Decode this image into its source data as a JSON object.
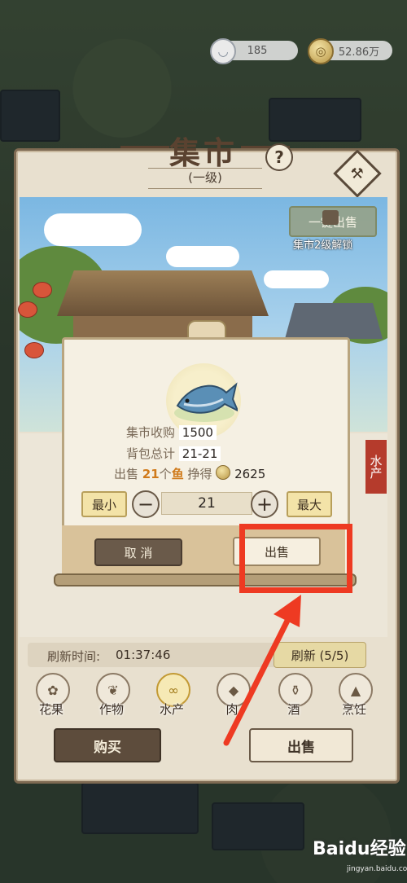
{
  "currency": {
    "bowl_value": "185",
    "coin_value": "52.86万"
  },
  "market": {
    "title": "集市",
    "level": "(一级)",
    "help_symbol": "?",
    "one_click_sell": "一键出售",
    "unlock_note": "集市2级解锁",
    "category_tag": "水产"
  },
  "sell_dialog": {
    "market_buy_label": "集市收购",
    "market_buy_value": "1500",
    "bag_total_label": "背包总计",
    "bag_total_value": "21-21",
    "sell_prefix": "出售",
    "sell_count": "21",
    "sell_unit": "个",
    "sell_item": "鱼",
    "earn_label": "挣得",
    "earn_value": "2625",
    "min_label": "最小",
    "max_label": "最大",
    "minus_symbol": "−",
    "plus_symbol": "+",
    "quantity": "21",
    "cancel_label": "取 消",
    "sell_label": "出售"
  },
  "refresh": {
    "label": "刷新时间:",
    "time": "01:37:46",
    "button": "刷新 (5/5)"
  },
  "categories": [
    {
      "label": "花果",
      "icon": "flower-fruit-icon",
      "active": false
    },
    {
      "label": "作物",
      "icon": "crop-icon",
      "active": false
    },
    {
      "label": "水产",
      "icon": "aquatic-icon",
      "active": true
    },
    {
      "label": "肉",
      "icon": "meat-icon",
      "active": false
    },
    {
      "label": "酒",
      "icon": "wine-icon",
      "active": false
    },
    {
      "label": "烹饪",
      "icon": "cooking-icon",
      "active": false
    }
  ],
  "bottom": {
    "buy": "购买",
    "sell": "出售"
  },
  "watermark": {
    "brand": "Baidu经验",
    "url": "jingyan.baidu.com"
  },
  "colors": {
    "annotation_red": "#ee3a22",
    "active_gold": "#c39a34"
  }
}
